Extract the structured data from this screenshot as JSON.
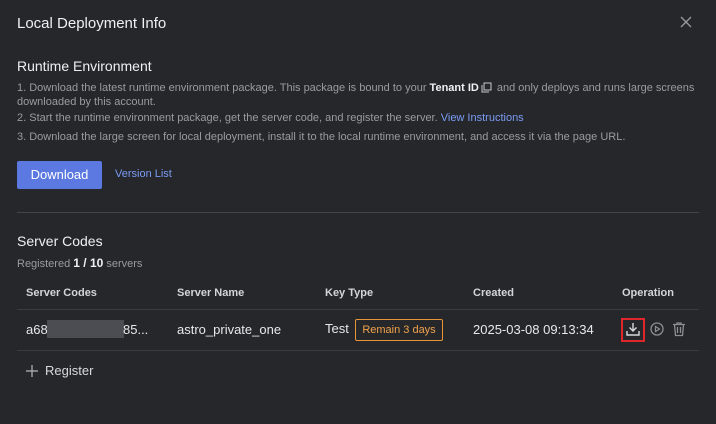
{
  "dialog": {
    "title": "Local Deployment Info",
    "close_icon": "close-icon"
  },
  "runtime": {
    "title": "Runtime Environment",
    "step1_pre": "1. Download the latest runtime environment package. This package is bound to your ",
    "step1_strong": "Tenant ID",
    "step1_post": " and only deploys and runs large screens downloaded by this account.",
    "step2_pre": "2. Start the runtime environment package, get the server code, and register the server. ",
    "step2_link": "View Instructions",
    "step3": "3. Download the large screen for local deployment, install it to the local runtime environment, and access it via the page URL.",
    "download_label": "Download",
    "version_list_label": "Version List"
  },
  "server_codes": {
    "title": "Server Codes",
    "registered_pre": "Registered ",
    "registered_count": "1 / 10",
    "registered_post": " servers",
    "columns": [
      "Server Codes",
      "Server Name",
      "Key Type",
      "Created",
      "Operation"
    ],
    "rows": [
      {
        "code_prefix": "a68",
        "code_suffix": "85...",
        "name": "astro_private_one",
        "key_type": "Test",
        "badge": "Remain 3 days",
        "created": "2025-03-08 09:13:34"
      }
    ],
    "register_label": "Register"
  },
  "colors": {
    "background": "#26272b",
    "accent": "#5b79e0",
    "link": "#7b9cf5",
    "warning": "#e8943a",
    "highlight": "#e0262b"
  }
}
